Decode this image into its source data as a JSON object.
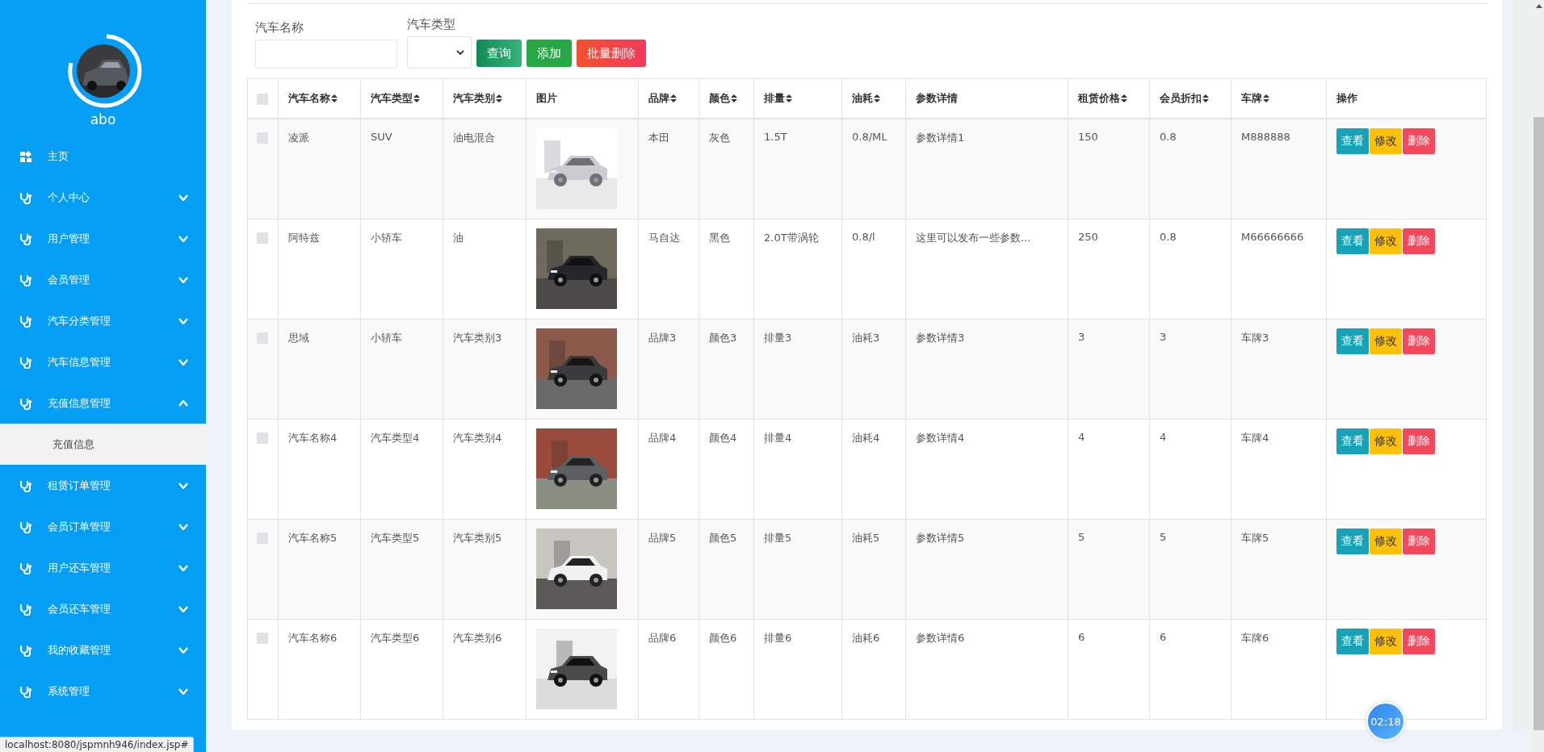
{
  "sidebar": {
    "user": {
      "name": "abo",
      "avatar": {
        "kind": "picture"
      }
    },
    "items": [
      {
        "label": "主页",
        "kind": "home"
      },
      {
        "label": "个人中心",
        "kind": "group",
        "expanded": false
      },
      {
        "label": "用户管理",
        "kind": "group",
        "expanded": false
      },
      {
        "label": "会员管理",
        "kind": "group",
        "expanded": false
      },
      {
        "label": "汽车分类管理",
        "kind": "group",
        "expanded": false
      },
      {
        "label": "汽车信息管理",
        "kind": "group",
        "expanded": false
      },
      {
        "label": "充值信息管理",
        "kind": "group",
        "expanded": true,
        "children": [
          {
            "label": "充值信息"
          }
        ]
      },
      {
        "label": "租赁订单管理",
        "kind": "group",
        "expanded": false
      },
      {
        "label": "会员订单管理",
        "kind": "group",
        "expanded": false
      },
      {
        "label": "用户还车管理",
        "kind": "group",
        "expanded": false
      },
      {
        "label": "会员还车管理",
        "kind": "group",
        "expanded": false
      },
      {
        "label": "我的收藏管理",
        "kind": "group",
        "expanded": false
      },
      {
        "label": "系统管理",
        "kind": "group",
        "expanded": false
      }
    ]
  },
  "search": {
    "fields": [
      {
        "label": "汽车名称",
        "kind": "text"
      },
      {
        "label": "汽车类型",
        "kind": "select"
      }
    ],
    "buttons": [
      {
        "label": "查询",
        "kind": "query"
      },
      {
        "label": "添加",
        "kind": "add"
      },
      {
        "label": "批量删除",
        "kind": "batch-delete"
      }
    ]
  },
  "table": {
    "select_all": {
      "checked": false
    },
    "columns": [
      {
        "label": "汽车名称",
        "sortable": true
      },
      {
        "label": "汽车类型",
        "sortable": true
      },
      {
        "label": "汽车类别",
        "sortable": true
      },
      {
        "label": "图片",
        "sortable": false
      },
      {
        "label": "品牌",
        "sortable": true
      },
      {
        "label": "颜色",
        "sortable": true
      },
      {
        "label": "排量",
        "sortable": true
      },
      {
        "label": "油耗",
        "sortable": true
      },
      {
        "label": "参数详情",
        "sortable": false
      },
      {
        "label": "租赁价格",
        "sortable": true
      },
      {
        "label": "会员折扣",
        "sortable": true
      },
      {
        "label": "车牌",
        "sortable": true
      },
      {
        "label": "操作",
        "sortable": false
      }
    ],
    "rows": [
      {
        "checked": false,
        "cells": [
          "凌派",
          "SUV",
          "油电混合",
          {
            "kind": "picture"
          },
          "本田",
          "灰色",
          "1.5T",
          "0.8/ML",
          "参数详情1",
          "150",
          "0.8",
          "M888888"
        ],
        "actions": [
          {
            "label": "查看",
            "kind": "view"
          },
          {
            "label": "修改",
            "kind": "edit"
          },
          {
            "label": "删除",
            "kind": "delete"
          }
        ]
      },
      {
        "checked": false,
        "cells": [
          "阿特兹",
          "小轿车",
          "油",
          {
            "kind": "picture"
          },
          "马自达",
          "黑色",
          "2.0T带涡轮",
          "0.8/l",
          "这里可以发布一些参数...",
          "250",
          "0.8",
          "M66666666"
        ],
        "actions": [
          {
            "label": "查看",
            "kind": "view"
          },
          {
            "label": "修改",
            "kind": "edit"
          },
          {
            "label": "删除",
            "kind": "delete"
          }
        ]
      },
      {
        "checked": false,
        "cells": [
          "思域",
          "小轿车",
          "汽车类别3",
          {
            "kind": "picture"
          },
          "品牌3",
          "颜色3",
          "排量3",
          "油耗3",
          "参数详情3",
          "3",
          "3",
          "车牌3"
        ],
        "actions": [
          {
            "label": "查看",
            "kind": "view"
          },
          {
            "label": "修改",
            "kind": "edit"
          },
          {
            "label": "删除",
            "kind": "delete"
          }
        ]
      },
      {
        "checked": false,
        "cells": [
          "汽车名称4",
          "汽车类型4",
          "汽车类别4",
          {
            "kind": "picture"
          },
          "品牌4",
          "颜色4",
          "排量4",
          "油耗4",
          "参数详情4",
          "4",
          "4",
          "车牌4"
        ],
        "actions": [
          {
            "label": "查看",
            "kind": "view"
          },
          {
            "label": "修改",
            "kind": "edit"
          },
          {
            "label": "删除",
            "kind": "delete"
          }
        ]
      },
      {
        "checked": false,
        "cells": [
          "汽车名称5",
          "汽车类型5",
          "汽车类别5",
          {
            "kind": "picture"
          },
          "品牌5",
          "颜色5",
          "排量5",
          "油耗5",
          "参数详情5",
          "5",
          "5",
          "车牌5"
        ],
        "actions": [
          {
            "label": "查看",
            "kind": "view"
          },
          {
            "label": "修改",
            "kind": "edit"
          },
          {
            "label": "删除",
            "kind": "delete"
          }
        ]
      },
      {
        "checked": false,
        "cells": [
          "汽车名称6",
          "汽车类型6",
          "汽车类别6",
          {
            "kind": "picture"
          },
          "品牌6",
          "颜色6",
          "排量6",
          "油耗6",
          "参数详情6",
          "6",
          "6",
          "车牌6"
        ],
        "actions": [
          {
            "label": "查看",
            "kind": "view"
          },
          {
            "label": "修改",
            "kind": "edit"
          },
          {
            "label": "删除",
            "kind": "delete"
          }
        ]
      }
    ]
  },
  "timer_badge": "02:18",
  "status_bar": "localhost:8080/jspmnh946/index.jsp#"
}
